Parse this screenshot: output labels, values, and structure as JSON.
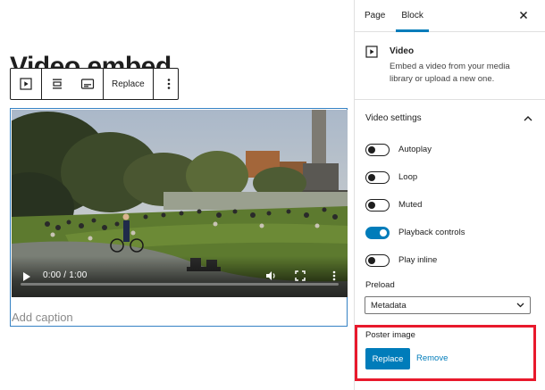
{
  "editor": {
    "post_title": "Video embed",
    "toolbar": {
      "replace_label": "Replace"
    },
    "video": {
      "time_label": "0:00 / 1:00",
      "progress": 0
    },
    "caption_placeholder": "Add caption"
  },
  "sidebar": {
    "tabs": [
      {
        "label": "Page",
        "active": false
      },
      {
        "label": "Block",
        "active": true
      }
    ],
    "block_card": {
      "title": "Video",
      "description": "Embed a video from your media library or upload a new one."
    },
    "video_settings": {
      "title": "Video settings",
      "toggles": [
        {
          "label": "Autoplay",
          "on": false
        },
        {
          "label": "Loop",
          "on": false
        },
        {
          "label": "Muted",
          "on": false
        },
        {
          "label": "Playback controls",
          "on": true
        },
        {
          "label": "Play inline",
          "on": false
        }
      ],
      "preload_label": "Preload",
      "preload_value": "Metadata"
    },
    "poster": {
      "label": "Poster image",
      "replace_label": "Replace",
      "remove_label": "Remove"
    }
  },
  "colors": {
    "accent": "#007cba",
    "highlight": "#e8192c",
    "selection_border": "#3582c4"
  }
}
